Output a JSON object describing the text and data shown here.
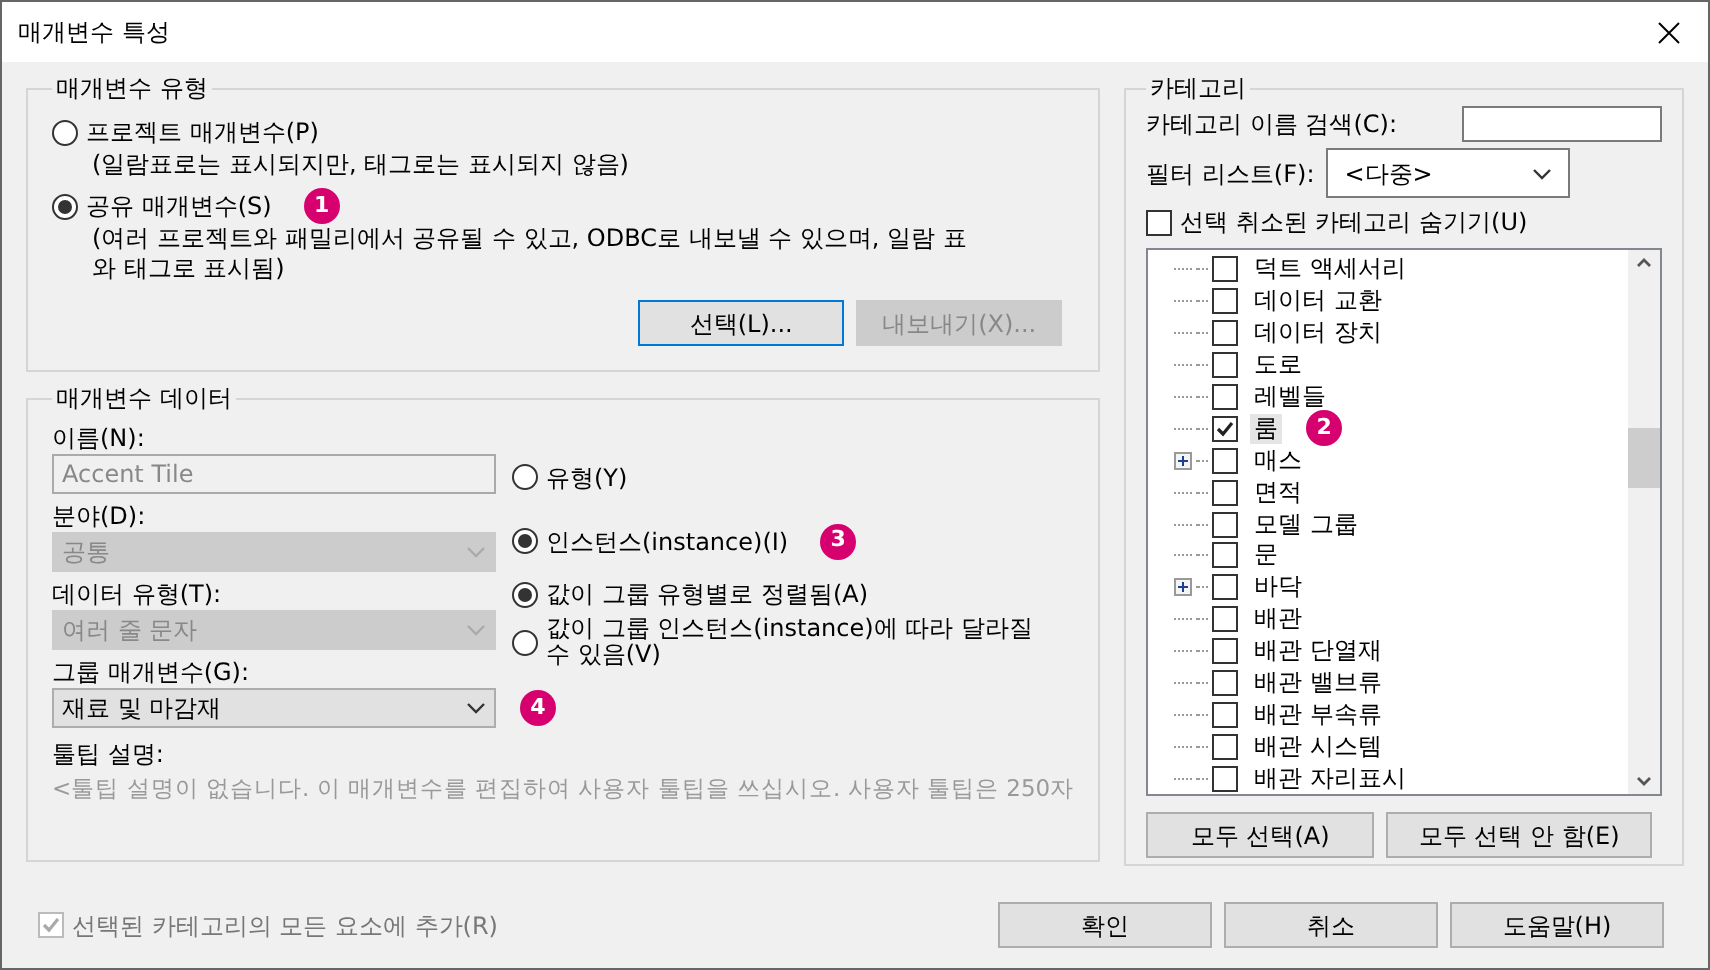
{
  "window": {
    "title": "매개변수 특성"
  },
  "parameter_type": {
    "title": "매개변수 유형",
    "options": [
      {
        "label": "프로젝트 매개변수(P)",
        "description": "(일람표로는 표시되지만, 태그로는 표시되지 않음)",
        "selected": false
      },
      {
        "label": "공유 매개변수(S)",
        "description": "(여러 프로젝트와 패밀리에서 공유될 수 있고, ODBC로 내보낼 수 있으며, 일람 표와 태그로 표시됨)",
        "selected": true,
        "badge": "1"
      }
    ],
    "buttons": [
      {
        "label": "선택(L)...",
        "disabled": false
      },
      {
        "label": "내보내기(X)...",
        "disabled": true
      }
    ]
  },
  "parameter_data": {
    "title": "매개변수 데이터",
    "fields": [
      {
        "kind": "input",
        "label": "이름(N):",
        "value": "Accent Tile",
        "disabled": true
      },
      {
        "kind": "select",
        "label": "분야(D):",
        "value": "공통",
        "disabled": true
      },
      {
        "kind": "select",
        "label": "데이터 유형(T):",
        "value": "여러 줄 문자",
        "disabled": true
      },
      {
        "kind": "select",
        "label": "그룹 매개변수(G):",
        "value": "재료 및 마감재",
        "disabled": false,
        "badge": "4"
      }
    ],
    "type_options": [
      {
        "label": "유형(Y)",
        "selected": false
      },
      {
        "label": "인스턴스(instance)(I)",
        "selected": true,
        "badge": "3"
      }
    ],
    "value_options": [
      {
        "label": "값이 그룹 유형별로 정렬됨(A)",
        "selected": true
      },
      {
        "label": "값이 그룹 인스턴스(instance)에 따라 달라질 수 있음(V)",
        "selected": false
      }
    ],
    "tooltip_label": "툴팁 설명:",
    "tooltip_text": "<툴팁 설명이 없습니다. 이 매개변수를 편집하여 사용자 툴팁을 쓰십시오. 사용자 툴팁은 250자"
  },
  "add_to_all": {
    "label": "선택된 카테고리의 모든 요소에 추가(R)",
    "checked": true,
    "disabled": true
  },
  "categories": {
    "title": "카테고리",
    "search_label": "카테고리 이름 검색(C):",
    "filter_label": "필터 리스트(F):",
    "filter_value": "<다중>",
    "hide_unchecked": {
      "label": "선택 취소된 카테고리 숨기기(U)",
      "checked": false
    },
    "items": [
      {
        "label": "덕트 액세서리",
        "checked": false,
        "expandable": false,
        "selected": false
      },
      {
        "label": "데이터 교환",
        "checked": false,
        "expandable": false,
        "selected": false
      },
      {
        "label": "데이터 장치",
        "checked": false,
        "expandable": false,
        "selected": false
      },
      {
        "label": "도로",
        "checked": false,
        "expandable": false,
        "selected": false
      },
      {
        "label": "레벨들",
        "checked": false,
        "expandable": false,
        "selected": false
      },
      {
        "label": "룸",
        "checked": true,
        "expandable": false,
        "selected": true,
        "badge": "2"
      },
      {
        "label": "매스",
        "checked": false,
        "expandable": true,
        "selected": false
      },
      {
        "label": "면적",
        "checked": false,
        "expandable": false,
        "selected": false
      },
      {
        "label": "모델 그룹",
        "checked": false,
        "expandable": false,
        "selected": false
      },
      {
        "label": "문",
        "checked": false,
        "expandable": false,
        "selected": false
      },
      {
        "label": "바닥",
        "checked": false,
        "expandable": true,
        "selected": false
      },
      {
        "label": "배관",
        "checked": false,
        "expandable": false,
        "selected": false
      },
      {
        "label": "배관 단열재",
        "checked": false,
        "expandable": false,
        "selected": false
      },
      {
        "label": "배관 밸브류",
        "checked": false,
        "expandable": false,
        "selected": false
      },
      {
        "label": "배관 부속류",
        "checked": false,
        "expandable": false,
        "selected": false
      },
      {
        "label": "배관 시스템",
        "checked": false,
        "expandable": false,
        "selected": false
      },
      {
        "label": "배관 자리표시",
        "checked": false,
        "expandable": false,
        "selected": false
      }
    ],
    "buttons": [
      "모두 선택(A)",
      "모두 선택 안 함(E)"
    ]
  },
  "footer_buttons": [
    "확인",
    "취소",
    "도움말(H)"
  ]
}
